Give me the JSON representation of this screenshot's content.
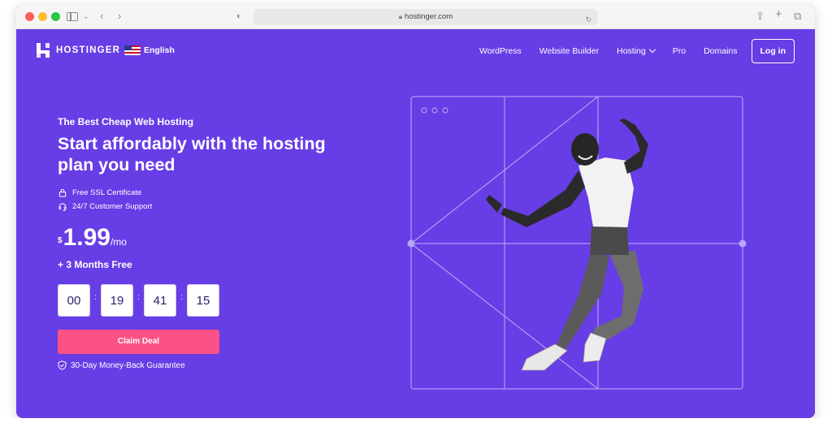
{
  "browser": {
    "url": "hostinger.com"
  },
  "header": {
    "logo_text": "HOSTINGER",
    "language": "English",
    "nav": [
      "WordPress",
      "Website Builder",
      "Hosting",
      "Pro",
      "Domains"
    ],
    "login_label": "Log in"
  },
  "hero": {
    "eyebrow": "The Best Cheap Web Hosting",
    "headline": "Start affordably with the hosting plan you need",
    "features": [
      "Free SSL Certificate",
      "24/7 Customer Support"
    ],
    "price": {
      "currency": "$",
      "amount": "1.99",
      "period": "/mo"
    },
    "bonus": "+ 3 Months Free",
    "timer": [
      "00",
      "19",
      "41",
      "15"
    ],
    "timer_separator": ":",
    "cta_label": "Claim Deal",
    "guarantee": "30-Day Money-Back Guarantee"
  },
  "colors": {
    "brand": "#673de6",
    "cta": "#fc5185"
  }
}
